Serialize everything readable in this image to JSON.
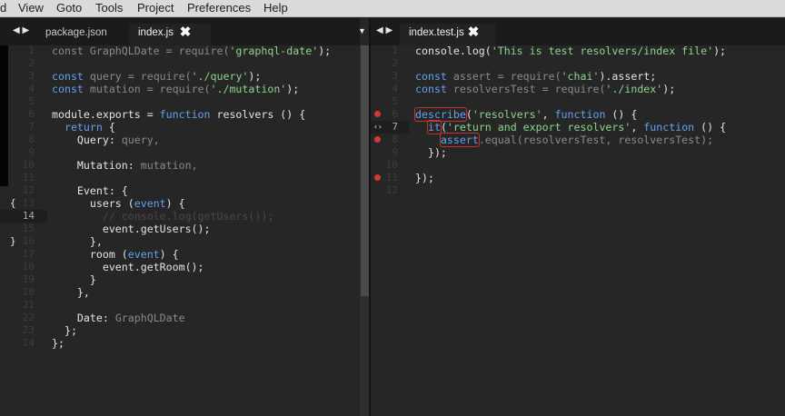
{
  "menu": {
    "items": [
      "d",
      "View",
      "Goto",
      "Tools",
      "Project",
      "Preferences",
      "Help"
    ]
  },
  "left_pane": {
    "tabs": [
      {
        "label": "package.json",
        "active": false
      },
      {
        "label": "index.js",
        "active": true,
        "close": "✖"
      }
    ],
    "nav_arrows": "◀ ▶",
    "current_line": 14,
    "lines": [
      [
        [
          "const GraphQLDate = require(",
          "dim"
        ],
        [
          "'graphql-date'",
          "str"
        ],
        [
          ");",
          "plain"
        ]
      ],
      [],
      [
        [
          "const",
          "kw"
        ],
        [
          " query = ",
          "dim"
        ],
        [
          "require(",
          "dim"
        ],
        [
          "'./query'",
          "str"
        ],
        [
          ");",
          "plain"
        ]
      ],
      [
        [
          "const",
          "kw"
        ],
        [
          " mutation = ",
          "dim"
        ],
        [
          "require(",
          "dim"
        ],
        [
          "'./mutation'",
          "str"
        ],
        [
          ");",
          "plain"
        ]
      ],
      [],
      [
        [
          "module.exports = ",
          "plain"
        ],
        [
          "function",
          "kw"
        ],
        [
          " resolvers () {",
          "plain"
        ]
      ],
      [
        [
          "  return",
          "kw"
        ],
        [
          " {",
          "plain"
        ]
      ],
      [
        [
          "    Query: ",
          "plain"
        ],
        [
          "query,",
          "dim"
        ]
      ],
      [],
      [
        [
          "    Mutation: ",
          "plain"
        ],
        [
          "mutation,",
          "dim"
        ]
      ],
      [],
      [
        [
          "    Event: {",
          "plain"
        ]
      ],
      [
        [
          "      users (",
          "plain"
        ],
        [
          "event",
          "kw"
        ],
        [
          ") {",
          "plain"
        ]
      ],
      [
        [
          "        // console.log(getUsers());",
          "cmt"
        ]
      ],
      [
        [
          "        event.getUsers();",
          "plain"
        ]
      ],
      [
        [
          "      },",
          "plain"
        ]
      ],
      [
        [
          "      room (",
          "plain"
        ],
        [
          "event",
          "kw"
        ],
        [
          ") {",
          "plain"
        ]
      ],
      [
        [
          "        event.getRoom();",
          "plain"
        ]
      ],
      [
        [
          "      }",
          "plain"
        ]
      ],
      [
        [
          "    },",
          "plain"
        ]
      ],
      [],
      [
        [
          "    Date: ",
          "plain"
        ],
        [
          "GraphQLDate",
          "dim"
        ]
      ],
      [
        [
          "  };",
          "plain"
        ]
      ],
      [
        [
          "};",
          "plain"
        ]
      ]
    ],
    "fold_markers": [
      "{",
      "}"
    ]
  },
  "right_pane": {
    "tabs": [
      {
        "label": "index.test.js",
        "active": true,
        "close": "✖"
      }
    ],
    "dropdown": "▼",
    "nav_arrows": "◀ ▶",
    "current_line": 7,
    "breakpoint_lines": [
      6,
      8,
      11
    ],
    "lines": [
      [
        [
          "console.log(",
          "plain"
        ],
        [
          "'This is test resolvers/index file'",
          "str"
        ],
        [
          ");",
          "plain"
        ]
      ],
      [],
      [
        [
          "const",
          "kw"
        ],
        [
          " assert = ",
          "dim"
        ],
        [
          "require(",
          "dim"
        ],
        [
          "'chai'",
          "str"
        ],
        [
          ").assert;",
          "plain"
        ]
      ],
      [
        [
          "const",
          "kw"
        ],
        [
          " resolversTest = ",
          "dim"
        ],
        [
          "require(",
          "dim"
        ],
        [
          "'./index'",
          "str"
        ],
        [
          ");",
          "plain"
        ]
      ],
      [],
      [
        [
          "describe",
          "boxkw"
        ],
        [
          "(",
          "plain"
        ],
        [
          "'resolvers'",
          "str"
        ],
        [
          ", ",
          "plain"
        ],
        [
          "function",
          "kw"
        ],
        [
          " () {",
          "plain"
        ]
      ],
      [
        [
          "  ",
          "plain"
        ],
        [
          "it",
          "boxkw"
        ],
        [
          "(",
          "plain"
        ],
        [
          "'return and export resolvers'",
          "str"
        ],
        [
          ", ",
          "plain"
        ],
        [
          "function",
          "kw"
        ],
        [
          " () {",
          "plain"
        ]
      ],
      [
        [
          "    ",
          "plain"
        ],
        [
          "assert",
          "boxkw"
        ],
        [
          ".equal(resolversTest, resolversTest);",
          "dim"
        ]
      ],
      [
        [
          "  });",
          "plain"
        ]
      ],
      [],
      [
        [
          "});",
          "plain"
        ]
      ],
      []
    ],
    "fold_marker": "‹›"
  }
}
